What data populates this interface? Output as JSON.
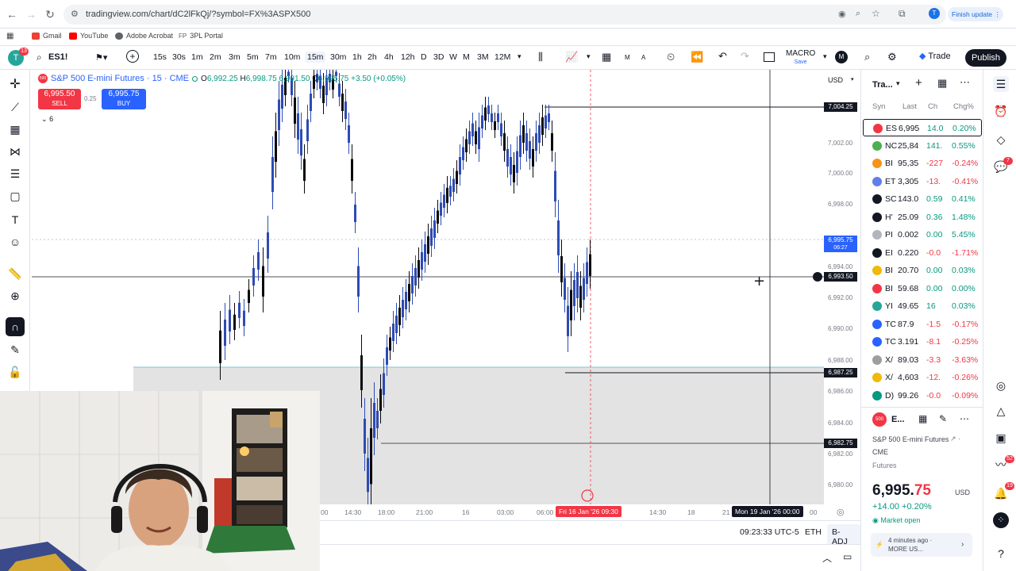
{
  "browser": {
    "url": "tradingview.com/chart/dC2lFkQj/?symbol=FX%3ASPX500",
    "update_label": "Finish update",
    "profile_initial": "T",
    "bookmarks": [
      "Gmail",
      "YouTube",
      "Adobe Acrobat",
      "3PL Portal"
    ]
  },
  "toolbar": {
    "avatar_initial": "T",
    "avatar_badge": "13",
    "symbol": "ES1!",
    "timeframes": [
      "15s",
      "30s",
      "1m",
      "2m",
      "3m",
      "5m",
      "7m",
      "10m",
      "15m",
      "30m",
      "1h",
      "2h",
      "4h",
      "12h",
      "D",
      "3D",
      "W",
      "M",
      "3M",
      "12M"
    ],
    "active_timeframe": "15m",
    "m_a": [
      "M",
      "A"
    ],
    "layout_name": "MACRO",
    "layout_sub": "Save",
    "layout_initial": "M",
    "trade_label": "Trade",
    "publish_label": "Publish"
  },
  "legend": {
    "title": "S&P 500 E-mini Futures · 15 · CME",
    "open_label": "O",
    "open": "6,992.25",
    "high_label": "H",
    "high": "6,998.75",
    "close_label": "C",
    "low_text": "6,991.50",
    "close": "6,995.75",
    "change": "+3.50 (+0.05%)",
    "sell_price": "6,995.50",
    "sell_label": "SELL",
    "buy_price": "6,995.75",
    "buy_label": "BUY",
    "spread": "0.25",
    "volume_count": "6"
  },
  "price_axis": {
    "currency": "USD",
    "ticks": [
      "7,002.00",
      "7,000.00",
      "6,998.00",
      "6,994.00",
      "6,992.00",
      "6,990.00",
      "6,988.00",
      "6,986.00",
      "6,984.00",
      "6,982.00",
      "6,980.00"
    ],
    "tag_top": "7,004.25",
    "tag_current": "6,995.75",
    "tag_timer": "06:27",
    "tag_cross": "6,993.50",
    "tag_mid": "6,987.25",
    "tag_low": "6,982.75"
  },
  "time_axis": {
    "labels": [
      "00",
      "14:30",
      "18:00",
      "21:00",
      "16",
      "03:00",
      "06:00",
      "14:30",
      "18",
      "21",
      "00"
    ],
    "highlight_left": "Fri 16 Jan '26   09:30",
    "highlight_right": "Mon 19 Jan '26   00:00"
  },
  "bottom": {
    "clock": "09:23:33 UTC-5",
    "session": "ETH",
    "adjust": "B-ADJ"
  },
  "watchlist": {
    "header": "Tra...",
    "col_symbol": "Syn",
    "col_last": "Last",
    "col_change": "Ch",
    "col_change_pct": "Chg%",
    "rows": [
      {
        "sym": "ES",
        "last": "6,995",
        "chg": "14.0",
        "pct": "0.20%",
        "dir": "pos",
        "color": "#f23645"
      },
      {
        "sym": "NC",
        "last": "25,84",
        "chg": "141.",
        "pct": "0.55%",
        "dir": "pos",
        "color": "#4caf50"
      },
      {
        "sym": "BI",
        "last": "95,35",
        "chg": "-227",
        "pct": "-0.24%",
        "dir": "neg",
        "color": "#f7931a"
      },
      {
        "sym": "ET",
        "last": "3,305",
        "chg": "-13.",
        "pct": "-0.41%",
        "dir": "neg",
        "color": "#627eea"
      },
      {
        "sym": "SC",
        "last": "143.0",
        "chg": "0.59",
        "pct": "0.41%",
        "dir": "pos",
        "color": "#131722"
      },
      {
        "sym": "H'",
        "last": "25.09",
        "chg": "0.36",
        "pct": "1.48%",
        "dir": "pos",
        "color": "#131722"
      },
      {
        "sym": "PI",
        "last": "0.002",
        "chg": "0.00",
        "pct": "5.45%",
        "dir": "pos",
        "color": "#b2b5be"
      },
      {
        "sym": "EI",
        "last": "0.220",
        "chg": "-0.0",
        "pct": "-1.71%",
        "dir": "neg",
        "color": "#131722"
      },
      {
        "sym": "BI",
        "last": "20.70",
        "chg": "0.00",
        "pct": "0.03%",
        "dir": "pos",
        "color": "#f0b90b"
      },
      {
        "sym": "BI",
        "last": "59.68",
        "chg": "0.00",
        "pct": "0.00%",
        "dir": "pos",
        "color": "#f23645"
      },
      {
        "sym": "YI",
        "last": "49.65",
        "chg": "16",
        "pct": "0.03%",
        "dir": "pos",
        "color": "#26a69a"
      },
      {
        "sym": "TC",
        "last": "87.9",
        "chg": "-1.5",
        "pct": "-0.17%",
        "dir": "neg",
        "color": "#2962ff"
      },
      {
        "sym": "TC",
        "last": "3.191",
        "chg": "-8.1",
        "pct": "-0.25%",
        "dir": "neg",
        "color": "#2962ff"
      },
      {
        "sym": "X/",
        "last": "89.03",
        "chg": "-3.3",
        "pct": "-3.63%",
        "dir": "neg",
        "color": "#9e9e9e"
      },
      {
        "sym": "X/",
        "last": "4,603",
        "chg": "-12.",
        "pct": "-0.26%",
        "dir": "neg",
        "color": "#f0b90b"
      },
      {
        "sym": "D)",
        "last": "99.26",
        "chg": "-0.0",
        "pct": "-0.09%",
        "dir": "neg",
        "color": "#089981"
      }
    ]
  },
  "details": {
    "badge": "500",
    "short_name": "E...",
    "full_name": "S&P 500 E-mini Futures",
    "exchange": "CME",
    "category": "Futures",
    "price_main": "6,995.",
    "price_frac": "75",
    "currency": "USD",
    "change": "+14.00",
    "change_pct": "+0.20%",
    "market_status": "Market open",
    "news_time": "4 minutes ago ·",
    "news_more": "MORE US..."
  },
  "right_icons": {
    "badge_alerts": "7",
    "badge_news": "52",
    "badge_notifications": "19"
  }
}
